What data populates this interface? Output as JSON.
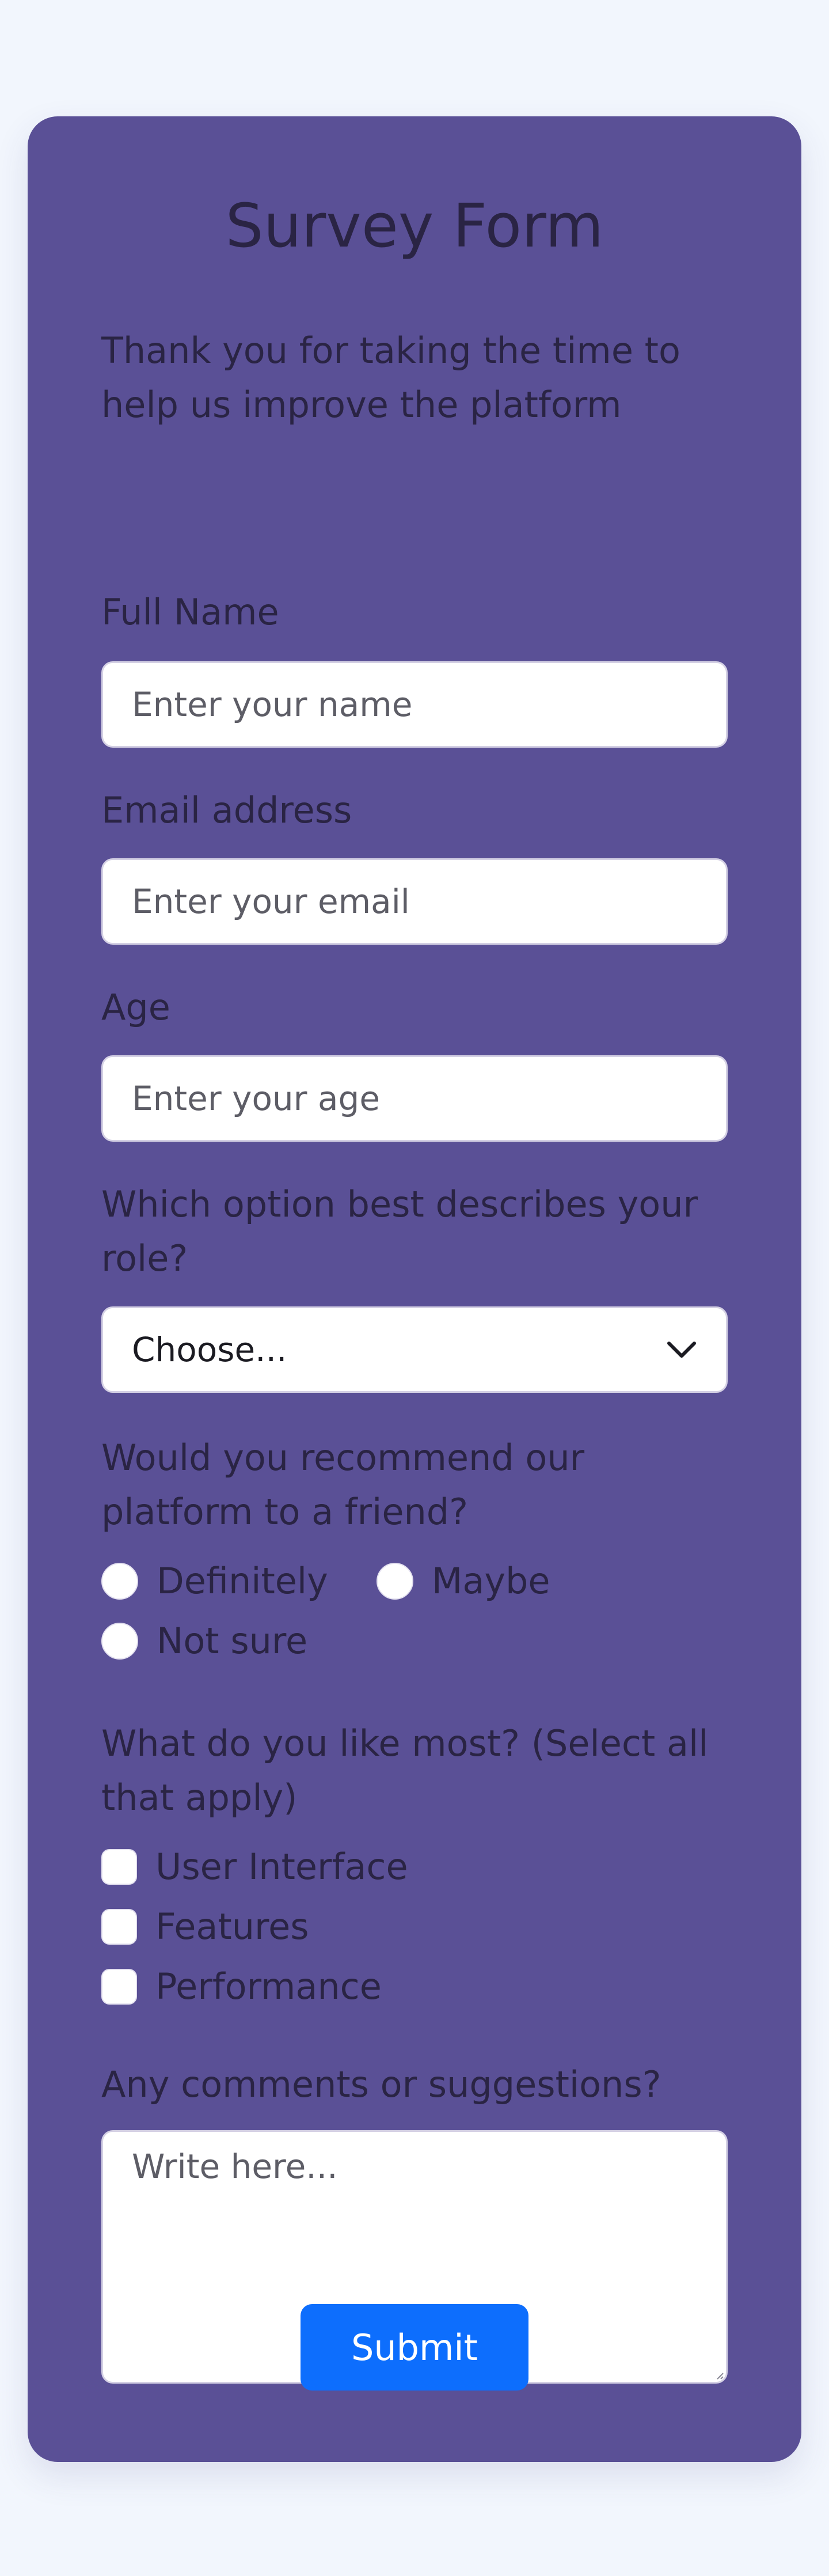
{
  "form": {
    "title": "Survey Form",
    "intro": "Thank you for taking the time to help us improve the platform",
    "name": {
      "label": "Full Name",
      "placeholder": "Enter your name"
    },
    "email": {
      "label": "Email address",
      "placeholder": "Enter your email"
    },
    "age": {
      "label": "Age",
      "placeholder": "Enter your age"
    },
    "role": {
      "label": "Which option best describes your role?",
      "selected": "Choose..."
    },
    "recommend": {
      "label": "Would you recommend our platform to a friend?",
      "options": [
        "Definitely",
        "Maybe",
        "Not sure"
      ]
    },
    "likes": {
      "label": "What do you like most? (Select all that apply)",
      "options": [
        "User Interface",
        "Features",
        "Performance"
      ]
    },
    "comments": {
      "label": "Any comments or suggestions?",
      "placeholder": "Write here..."
    },
    "submit_label": "Submit"
  },
  "colors": {
    "page_bg": "#f2f6fd",
    "card_bg": "#5a5096",
    "text": "#2a2444",
    "button_bg": "#0d6efd",
    "button_text": "#ffffff"
  },
  "icons": {
    "select_arrow": "chevron-down-icon",
    "textarea_resize": "resize-grip-icon"
  }
}
